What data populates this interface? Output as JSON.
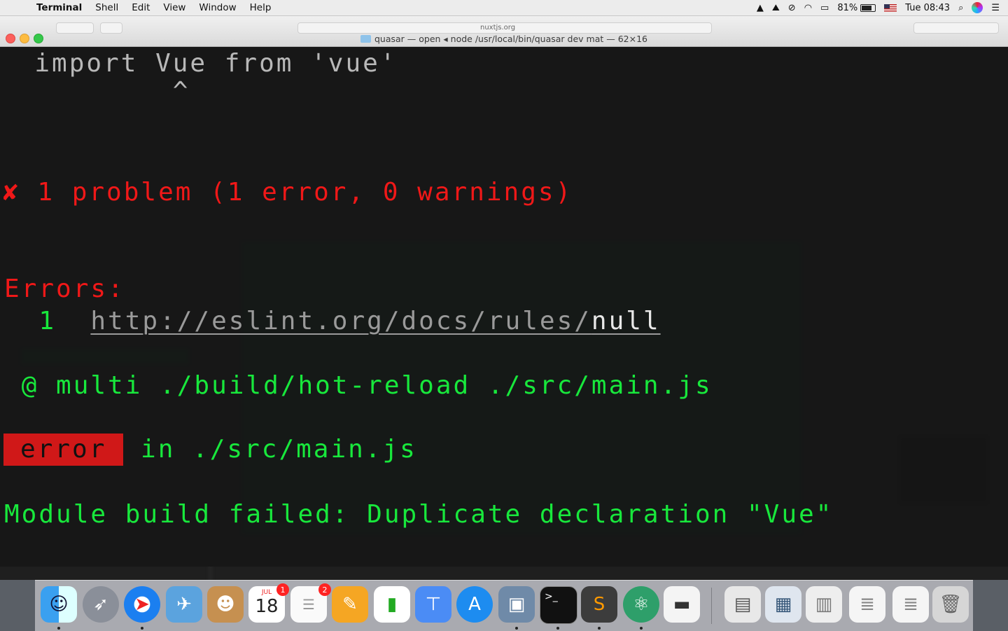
{
  "menubar": {
    "app": "Terminal",
    "items": [
      "Shell",
      "Edit",
      "View",
      "Window",
      "Help"
    ],
    "battery": "81%",
    "clock": "Tue 08:43"
  },
  "browser": {
    "url": "nuxtjs.org"
  },
  "window": {
    "title": "quasar — open ◂ node /usr/local/bin/quasar dev mat — 62×16"
  },
  "terminal": {
    "code_line": "  import Vue from 'vue'",
    "caret": "          ^",
    "problem": "✘ 1 problem (1 error, 0 warnings)",
    "errors_header": "Errors:",
    "error_count": "  1  ",
    "rule_url_base": "http://eslint.org/docs/rules/",
    "rule_url_tail": "null",
    "multi": " @ multi ./build/hot-reload ./src/main.js",
    "error_badge": "error",
    "error_in": " in ./src/main.js",
    "module_failed": "Module build failed: Duplicate declaration \"Vue\""
  },
  "colors": {
    "error_red": "#f01818",
    "success_green": "#18e83c",
    "text_gray": "#b8b8b8"
  },
  "dock": {
    "icons": [
      "finder-icon",
      "launchpad-icon",
      "safari-icon",
      "mail-icon",
      "contacts-icon",
      "calendar-icon",
      "reminders-icon",
      "pages-icon",
      "numbers-icon",
      "keynote-icon",
      "app-store-icon",
      "preview-icon",
      "terminal-icon",
      "sublime-text-icon",
      "atom-icon",
      "app-icon",
      "file-icon",
      "screenshot-icon",
      "spreadsheet-icon",
      "document-icon",
      "document-icon-2",
      "trash-icon"
    ],
    "calendar_month": "JUL",
    "calendar_day": "18",
    "calendar_badge": "1",
    "reminders_badge": "2"
  }
}
